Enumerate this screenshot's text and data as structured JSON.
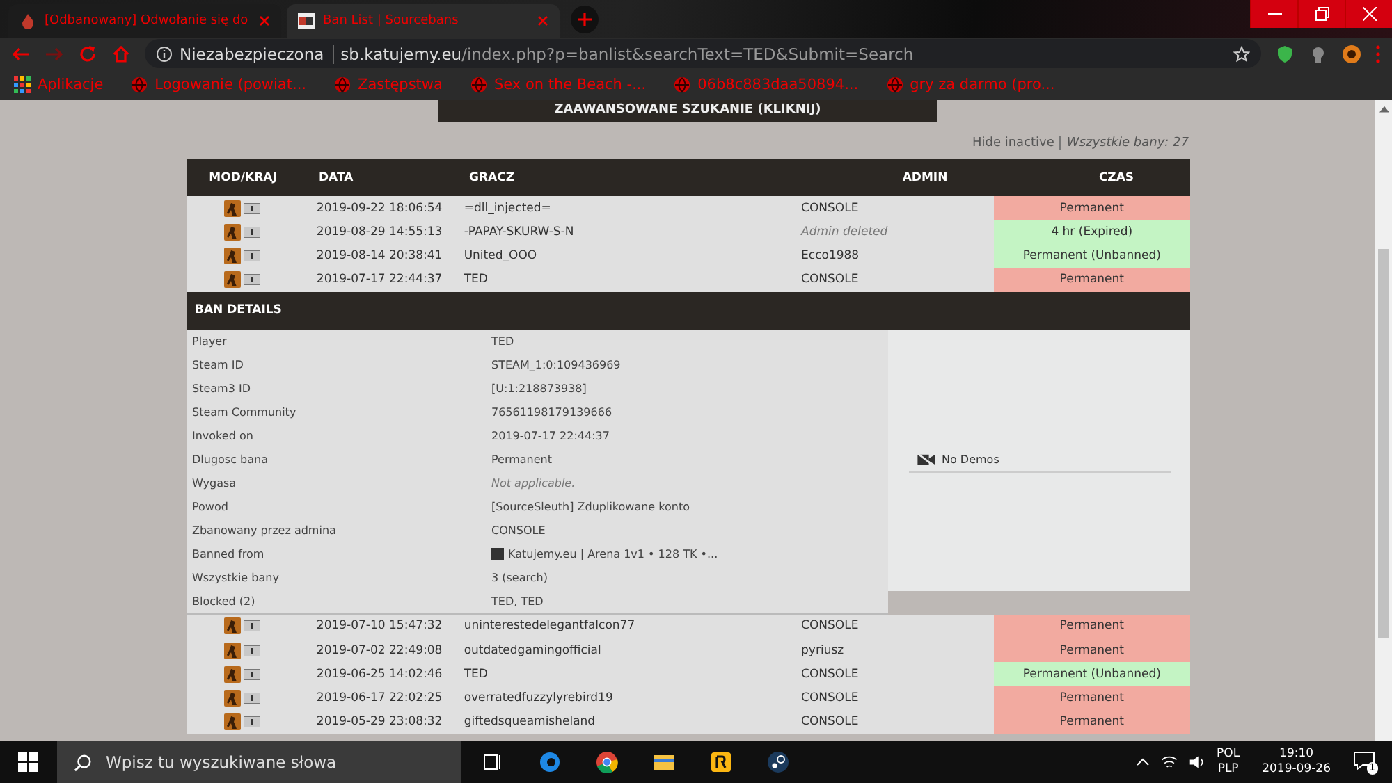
{
  "browser": {
    "tabs": [
      {
        "title": "[Odbanowany] Odwołanie się do",
        "selected": false
      },
      {
        "title": "Ban List | Sourcebans",
        "selected": true
      }
    ],
    "security": "Niezabezpieczona",
    "url_host": "sb.katujemy.eu",
    "url_path": "/index.php?p=banlist&searchText=TED&Submit=Search",
    "bookmarks": [
      "Aplikacje",
      "Logowanie (powiat...",
      "Zastępstwa",
      "Sex on the Beach -...",
      "06b8c883daa50894...",
      "gry za darmo (pro..."
    ]
  },
  "page": {
    "search_bar": "ZAAWANSOWANE SZUKANIE (KLIKNIJ)",
    "hide_inactive": "Hide inactive",
    "total": "Wszystkie bany: 27",
    "columns": [
      "MOD/KRAJ",
      "DATA",
      "GRACZ",
      "ADMIN",
      "CZAS"
    ],
    "rows_top": [
      {
        "date": "2019-09-22 18:06:54",
        "player": "=dll_injected=",
        "admin": "CONSOLE",
        "admin_deleted": false,
        "length": "Permanent",
        "kind": "active"
      },
      {
        "date": "2019-08-29 14:55:13",
        "player": "-PAPAY-SKURW-S-N",
        "admin": "Admin deleted",
        "admin_deleted": true,
        "length": "4 hr (Expired)",
        "kind": "inactive"
      },
      {
        "date": "2019-08-14 20:38:41",
        "player": "United_OOO",
        "admin": "Ecco1988",
        "admin_deleted": false,
        "length": "Permanent (Unbanned)",
        "kind": "inactive"
      },
      {
        "date": "2019-07-17 22:44:37",
        "player": "TED",
        "admin": "CONSOLE",
        "admin_deleted": false,
        "length": "Permanent",
        "kind": "active"
      }
    ],
    "details": {
      "title": "BAN DETAILS",
      "no_demos": "No Demos",
      "fields": [
        {
          "label": "Player",
          "value": "TED",
          "kind": "text"
        },
        {
          "label": "Steam ID",
          "value": "STEAM_1:0:109436969",
          "kind": "text"
        },
        {
          "label": "Steam3 ID",
          "value": "[U:1:218873938]",
          "kind": "text"
        },
        {
          "label": "Steam Community",
          "value": "76561198179139666",
          "kind": "text"
        },
        {
          "label": "Invoked on",
          "value": "2019-07-17 22:44:37",
          "kind": "text"
        },
        {
          "label": "Dlugosc bana",
          "value": "Permanent",
          "kind": "text"
        },
        {
          "label": "Wygasa",
          "value": "Not applicable.",
          "kind": "note"
        },
        {
          "label": "Powod",
          "value": "[SourceSleuth] Zduplikowane konto",
          "kind": "text"
        },
        {
          "label": "Zbanowany przez admina",
          "value": "CONSOLE",
          "kind": "text"
        },
        {
          "label": "Banned from",
          "value": "Katujemy.eu | Arena 1v1 • 128 TK •...",
          "kind": "server"
        },
        {
          "label": "Wszystkie bany",
          "value": "3 (search)",
          "kind": "text"
        },
        {
          "label": "Blocked (2)",
          "value": "TED, TED",
          "kind": "text"
        }
      ]
    },
    "rows_bottom": [
      {
        "date": "2019-07-10 15:47:32",
        "player": "uninterestedelegantfalcon77",
        "admin": "CONSOLE",
        "admin_deleted": false,
        "length": "Permanent",
        "kind": "active"
      },
      {
        "date": "2019-07-02 22:49:08",
        "player": "outdatedgamingofficial",
        "admin": "pyriusz",
        "admin_deleted": false,
        "length": "Permanent",
        "kind": "active"
      },
      {
        "date": "2019-06-25 14:02:46",
        "player": "TED",
        "admin": "CONSOLE",
        "admin_deleted": false,
        "length": "Permanent (Unbanned)",
        "kind": "inactive"
      },
      {
        "date": "2019-06-17 22:02:25",
        "player": "overratedfuzzylyrebird19",
        "admin": "CONSOLE",
        "admin_deleted": false,
        "length": "Permanent",
        "kind": "active"
      },
      {
        "date": "2019-05-29 23:08:32",
        "player": "giftedsqueamisheland",
        "admin": "CONSOLE",
        "admin_deleted": false,
        "length": "Permanent",
        "kind": "active"
      }
    ]
  },
  "taskbar": {
    "search_placeholder": "Wpisz tu wyszukiwane słowa",
    "lang": "POL",
    "layout": "PLP",
    "time": "19:10",
    "date": "2019-09-26",
    "notifications": "1"
  }
}
